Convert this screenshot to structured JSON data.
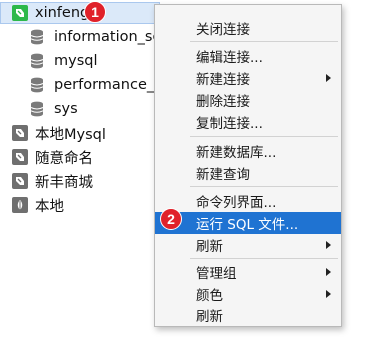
{
  "tree": {
    "connections": [
      {
        "label": "xinfeng",
        "icon": "mysql-connection-icon",
        "color": "#2db84a",
        "open": true
      },
      {
        "label": "本地Mysql",
        "icon": "mysql-connection-icon",
        "color": "#6f6f6f"
      },
      {
        "label": "随意命名",
        "icon": "mysql-connection-icon",
        "color": "#6f6f6f"
      },
      {
        "label": "新丰商城",
        "icon": "mysql-connection-icon",
        "color": "#6f6f6f"
      },
      {
        "label": "本地",
        "icon": "mongodb-connection-icon",
        "color": "#6f6f6f"
      }
    ],
    "databases": [
      {
        "label": "information_sc",
        "icon": "database-icon"
      },
      {
        "label": "mysql",
        "icon": "database-icon"
      },
      {
        "label": "performance_",
        "icon": "database-icon"
      },
      {
        "label": "sys",
        "icon": "database-icon"
      }
    ]
  },
  "badges": {
    "step1": "1",
    "step2": "2",
    "color": "#e0212a"
  },
  "context_menu": {
    "items": [
      {
        "label": "关闭连接"
      },
      {
        "label": "编辑连接..."
      },
      {
        "label": "新建连接",
        "submenu": true
      },
      {
        "label": "删除连接"
      },
      {
        "label": "复制连接..."
      },
      {
        "label": "新建数据库..."
      },
      {
        "label": "新建查询"
      },
      {
        "label": "命令列界面..."
      },
      {
        "label": "运行 SQL 文件...",
        "highlighted": true,
        "highlight_color": "#1f73d2"
      },
      {
        "label": "刷新",
        "submenu": true
      },
      {
        "label": "管理组",
        "submenu": true
      },
      {
        "label": "颜色",
        "submenu": true
      },
      {
        "label": "刷新"
      }
    ]
  }
}
